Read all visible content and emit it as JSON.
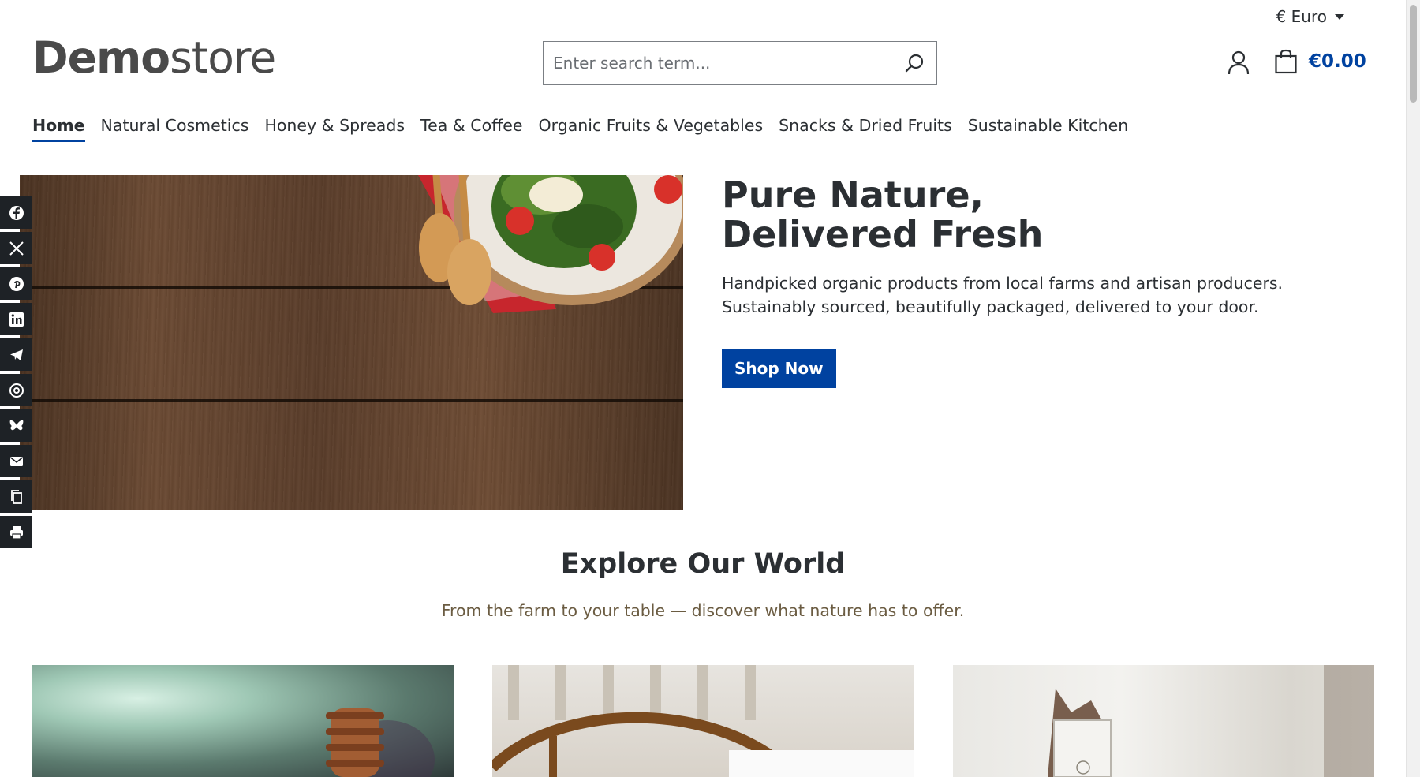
{
  "header": {
    "currency": "€ Euro",
    "logo_bold": "Demo",
    "logo_light": "store",
    "search_placeholder": "Enter search term...",
    "cart_total": "€0.00"
  },
  "nav": {
    "items": [
      {
        "label": "Home",
        "active": true
      },
      {
        "label": "Natural Cosmetics"
      },
      {
        "label": "Honey & Spreads"
      },
      {
        "label": "Tea & Coffee"
      },
      {
        "label": "Organic Fruits & Vegetables"
      },
      {
        "label": "Snacks & Dried Fruits"
      },
      {
        "label": "Sustainable Kitchen"
      }
    ]
  },
  "hero": {
    "title_line1": "Pure Nature,",
    "title_line2": "Delivered Fresh",
    "description": "Handpicked organic products from local farms and artisan producers. Sustainably sourced, beautifully packaged, delivered to your door.",
    "button_label": "Shop Now"
  },
  "social": {
    "icons": [
      "facebook-icon",
      "x-icon",
      "pinterest-icon",
      "linkedin-icon",
      "telegram-icon",
      "threads-icon",
      "bluesky-icon",
      "email-icon",
      "copy-link-icon",
      "print-icon"
    ]
  },
  "explore": {
    "title": "Explore Our World",
    "subtitle": "From the farm to your table — discover what nature has to offer."
  },
  "colors": {
    "accent": "#0042a0",
    "text": "#2b2f33",
    "subtitle": "#6b5c42",
    "social_bg": "#1e2226"
  }
}
